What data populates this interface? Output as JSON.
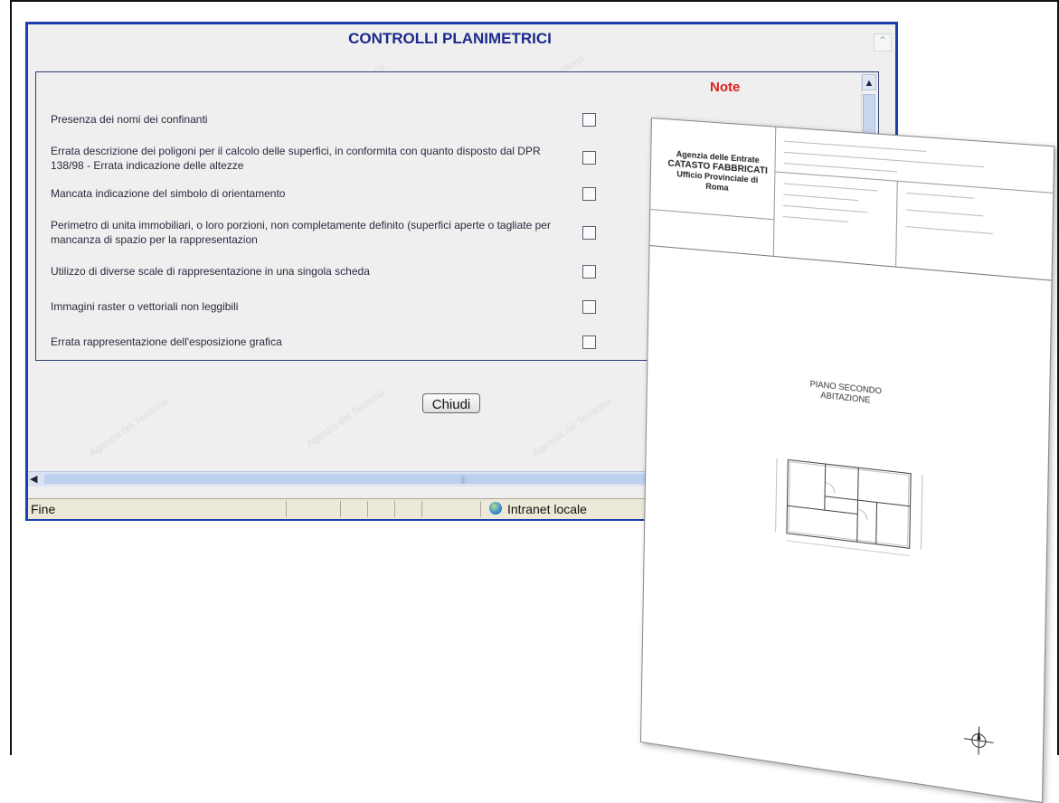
{
  "window": {
    "title": "CONTROLLI PLANIMETRICI",
    "note_header": "Note",
    "checks": [
      {
        "label": "Presenza dei nomi dei confinanti",
        "checked": false
      },
      {
        "label": "Errata descrizione dei poligoni per il calcolo delle superfici, in conformita con quanto disposto dal DPR 138/98 - Errata indicazione delle altezze",
        "checked": false
      },
      {
        "label": "Mancata indicazione del simbolo di orientamento",
        "checked": false
      },
      {
        "label": "Perimetro di unita immobiliari, o loro porzioni, non completamente definito (superfici aperte o tagliate per mancanza di spazio per la rappresentazion",
        "checked": false
      },
      {
        "label": "Utilizzo di diverse scale di rappresentazione in una singola scheda",
        "checked": false
      },
      {
        "label": "Immagini raster o vettoriali non leggibili",
        "checked": false
      },
      {
        "label": "Errata rappresentazione dell'esposizione grafica",
        "checked": false
      }
    ],
    "close_label": "Chiudi",
    "status_text": "Fine",
    "zone_label": "Intranet locale"
  },
  "document": {
    "agency_lines": [
      "Agenzia delle Entrate",
      "CATASTO FABBRICATI",
      "Ufficio Provinciale di",
      "Roma"
    ],
    "plan_title_lines": [
      "PIANO SECONDO",
      "ABITAZIONE"
    ]
  },
  "icons": {
    "checkbox": "checkbox-icon",
    "globe": "intranet-globe-icon",
    "compass": "compass-rose-icon",
    "scroll_up": "scroll-up-arrow-icon",
    "scroll_left": "scroll-left-arrow-icon"
  },
  "colors": {
    "window_border": "#1b3fb0",
    "title": "#1d2a8c",
    "note": "#e0201b"
  }
}
